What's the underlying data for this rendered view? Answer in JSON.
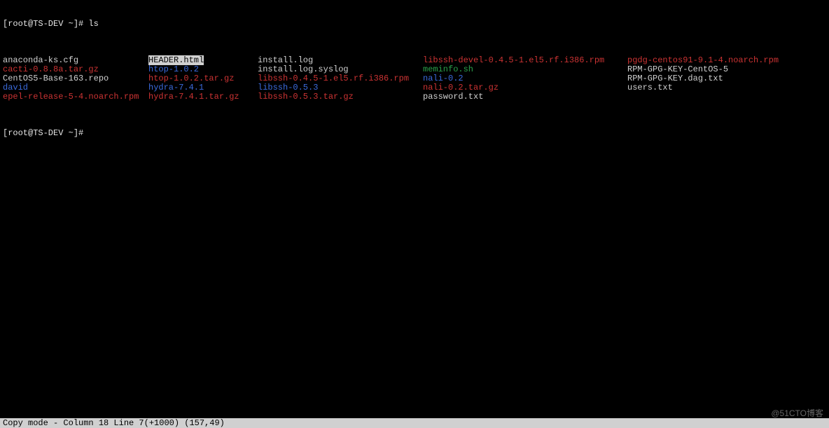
{
  "prompt_line": {
    "prompt": "[root@TS-DEV ~]# ",
    "command": "ls"
  },
  "listing": [
    [
      {
        "text": "anaconda-ks.cfg",
        "cls": "c-plain"
      },
      {
        "text": "HEADER.html",
        "cls": "highlight"
      },
      {
        "text": "install.log",
        "cls": "c-plain"
      },
      {
        "text": "libssh-devel-0.4.5-1.el5.rf.i386.rpm",
        "cls": "c-red"
      },
      {
        "text": "pgdg-centos91-9.1-4.noarch.rpm",
        "cls": "c-red"
      }
    ],
    [
      {
        "text": "cacti-0.8.8a.tar.gz",
        "cls": "c-red"
      },
      {
        "text": "htop-1.0.2",
        "cls": "c-blue"
      },
      {
        "text": "install.log.syslog",
        "cls": "c-plain"
      },
      {
        "text": "meminfo.sh",
        "cls": "c-green"
      },
      {
        "text": "RPM-GPG-KEY-CentOS-5",
        "cls": "c-plain"
      }
    ],
    [
      {
        "text": "CentOS5-Base-163.repo",
        "cls": "c-plain"
      },
      {
        "text": "htop-1.0.2.tar.gz",
        "cls": "c-red"
      },
      {
        "text": "libssh-0.4.5-1.el5.rf.i386.rpm",
        "cls": "c-red"
      },
      {
        "text": "nali-0.2",
        "cls": "c-blue"
      },
      {
        "text": "RPM-GPG-KEY.dag.txt",
        "cls": "c-plain"
      }
    ],
    [
      {
        "text": "david",
        "cls": "c-blue"
      },
      {
        "text": "hydra-7.4.1",
        "cls": "c-blue"
      },
      {
        "text": "libssh-0.5.3",
        "cls": "c-blue"
      },
      {
        "text": "nali-0.2.tar.gz",
        "cls": "c-red"
      },
      {
        "text": "users.txt",
        "cls": "c-plain"
      }
    ],
    [
      {
        "text": "epel-release-5-4.noarch.rpm",
        "cls": "c-red"
      },
      {
        "text": "hydra-7.4.1.tar.gz",
        "cls": "c-red"
      },
      {
        "text": "libssh-0.5.3.tar.gz",
        "cls": "c-red"
      },
      {
        "text": "password.txt",
        "cls": "c-plain"
      },
      {
        "text": "",
        "cls": "c-plain"
      }
    ]
  ],
  "prompt_after": "[root@TS-DEV ~]#",
  "status_bar": "Copy mode - Column 18 Line 7(+1000) (157,49)",
  "watermark": "@51CTO博客"
}
